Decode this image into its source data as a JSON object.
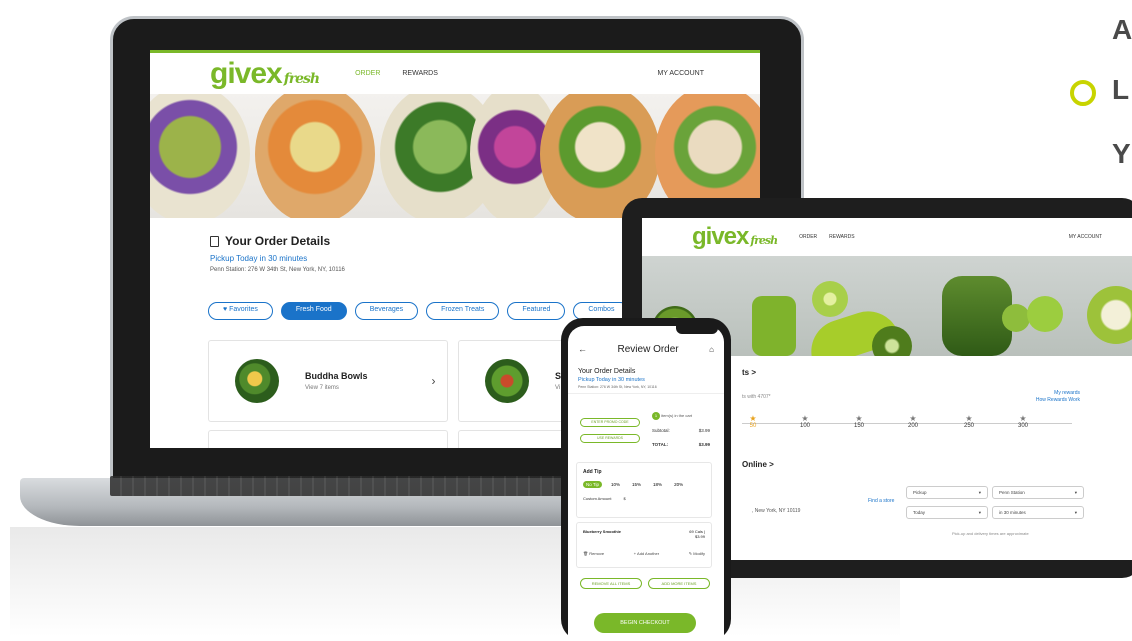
{
  "side_text": {
    "line1": "A",
    "line2": "L",
    "line3": "Y"
  },
  "colors": {
    "brand_green": "#7ab829",
    "link_blue": "#1a73c9",
    "bullet": "#c8d400"
  },
  "laptop": {
    "logo": "givex",
    "logo_script": "fresh",
    "nav": {
      "order": "ORDER",
      "rewards": "REWARDS",
      "account": "MY ACCOUNT"
    },
    "order_details": {
      "title": "Your Order Details",
      "pickup": "Pickup Today in 30 minutes",
      "address": "Penn Station: 276 W 34th St, New York, NY, 10116"
    },
    "categories": [
      {
        "label": "♥ Favorites",
        "active": false
      },
      {
        "label": "Fresh Food",
        "active": true
      },
      {
        "label": "Beverages",
        "active": false
      },
      {
        "label": "Frozen Treats",
        "active": false
      },
      {
        "label": "Featured",
        "active": false
      },
      {
        "label": "Combos",
        "active": false
      }
    ],
    "cards": [
      {
        "title": "Buddha Bowls",
        "sub": "View 7 items"
      },
      {
        "title": "Sa",
        "sub": "Vi"
      }
    ]
  },
  "tablet": {
    "logo": "givex",
    "logo_script": "fresh",
    "nav": {
      "order": "ORDER",
      "rewards": "REWARDS",
      "account": "MY ACCOUNT"
    },
    "rewards_head": "ts >",
    "rewards_sub": "ts with 4707*",
    "my_rewards": "My rewards",
    "how_rewards": "How Rewards Work",
    "points": [
      "50",
      "100",
      "150",
      "200",
      "250",
      "300"
    ],
    "online_head": "Online >",
    "address": ", New York, NY 10119",
    "find_store": "Find a store",
    "selects": {
      "mode": "Pickup",
      "store": "Penn Station",
      "day": "Today",
      "time": "in 30 minutes"
    },
    "note": "Pick-up and delivery times are approximate"
  },
  "phone": {
    "title": "Review Order",
    "details_title": "Your Order Details",
    "pickup": "Pickup Today in 30 minutes",
    "address": "Penn Station: 276 W 34th St, New York, NY, 10116",
    "buttons": {
      "promo": "ENTER PROMO CODE",
      "rewards": "USE REWARDS"
    },
    "cart_count": "1",
    "cart_note": "item(s) in the cart",
    "subtotal_label": "Subtotal:",
    "subtotal": "$3.99",
    "total_label": "TOTAL:",
    "total": "$3.99",
    "tip_head": "Add Tip",
    "tips": [
      "No Tip",
      "10%",
      "15%",
      "18%",
      "20%"
    ],
    "custom_label": "Custom Amount",
    "custom_value": "$",
    "item": {
      "name": "Blueberry Smoothie",
      "cals": "69 Cals |",
      "price": "$3.99"
    },
    "item_actions": {
      "remove": "Remove",
      "add": "Add Another",
      "modify": "Modify"
    },
    "remove_all": "REMOVE ALL ITEMS",
    "add_more": "ADD MORE ITEMS",
    "checkout": "BEGIN CHECKOUT"
  }
}
